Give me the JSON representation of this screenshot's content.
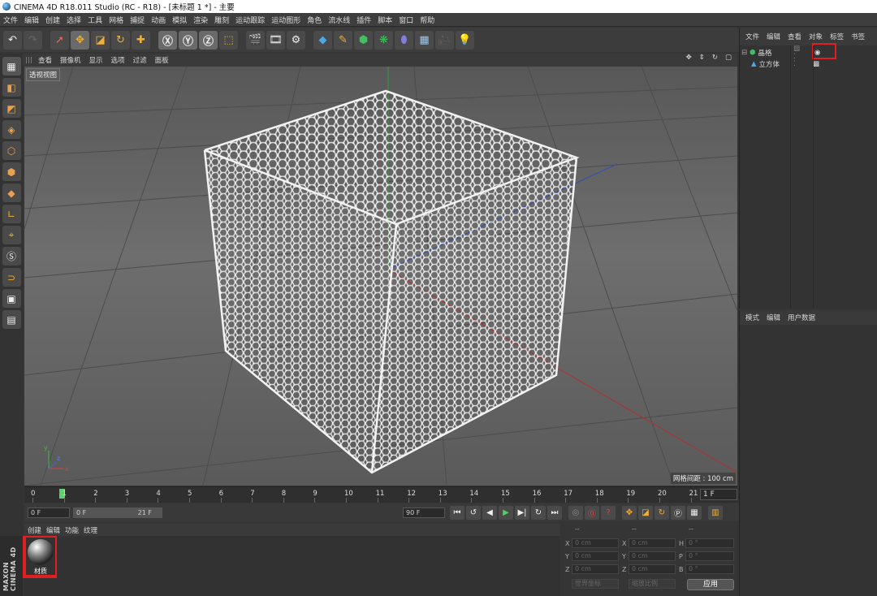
{
  "window": {
    "title": "CINEMA 4D R18.011 Studio (RC - R18) - [未标题 1 *] - 主要"
  },
  "menubar": [
    "文件",
    "编辑",
    "创建",
    "选择",
    "工具",
    "网格",
    "捕捉",
    "动画",
    "模拟",
    "渲染",
    "雕刻",
    "运动跟踪",
    "运动图形",
    "角色",
    "流水线",
    "插件",
    "脚本",
    "窗口",
    "帮助"
  ],
  "toolbar": {
    "icons": [
      "undo-icon",
      "redo-icon",
      "live-select-icon",
      "move-icon",
      "scale-icon",
      "rotate-icon",
      "last-tool-icon",
      "x-axis-icon",
      "y-axis-icon",
      "z-axis-icon",
      "coordinate-system-icon",
      "render-view-icon",
      "render-picture-viewer-icon",
      "render-settings-icon",
      "cube-object-icon",
      "pen-spline-icon",
      "subdivision-surface-icon",
      "cloner-icon",
      "deformer-icon",
      "floor-icon",
      "camera-icon",
      "light-icon"
    ]
  },
  "viewport": {
    "menu": [
      "查看",
      "摄像机",
      "显示",
      "选项",
      "过滤",
      "面板"
    ],
    "label": "透视视图",
    "grid_info": "网格间距 : 100 cm",
    "axis_x": "x",
    "axis_y": "y",
    "axis_z": "z"
  },
  "timeline": {
    "ticks": [
      "0",
      "1",
      "2",
      "3",
      "4",
      "5",
      "6",
      "7",
      "8",
      "9",
      "10",
      "11",
      "12",
      "13",
      "14",
      "15",
      "16",
      "17",
      "18",
      "19",
      "20",
      "21"
    ],
    "current_frame": "1 F"
  },
  "transport": {
    "start": "0 F",
    "range_start": "0 F",
    "range_end": "21 F",
    "end": "90 F"
  },
  "material_manager": {
    "menu": [
      "创建",
      "编辑",
      "功能",
      "纹理"
    ],
    "material_name": "材质"
  },
  "maxon": {
    "brand": "MAXON CINEMA 4D"
  },
  "coordinates": {
    "headers": [
      "--",
      "--",
      "--"
    ],
    "rows": [
      {
        "a": "X",
        "av": "0 cm",
        "b": "X",
        "bv": "0 cm",
        "c": "H",
        "cv": "0 °"
      },
      {
        "a": "Y",
        "av": "0 cm",
        "b": "Y",
        "bv": "0 cm",
        "c": "P",
        "cv": "0 °"
      },
      {
        "a": "Z",
        "av": "0 cm",
        "b": "Z",
        "bv": "0 cm",
        "c": "B",
        "cv": "0 °"
      }
    ],
    "mode_world": "世界坐标",
    "mode_scale": "缩放比例",
    "apply": "应用"
  },
  "object_manager": {
    "menu": [
      "文件",
      "编辑",
      "查看",
      "对象",
      "标签",
      "书签"
    ],
    "objects": [
      {
        "name": "晶格"
      },
      {
        "name": "立方体"
      }
    ]
  },
  "attribute_manager": {
    "menu": [
      "模式",
      "编辑",
      "用户数据"
    ]
  },
  "colors": {
    "highlight": "#e02020",
    "active_frame": "#5fd16a",
    "accent": "#4a90d9"
  }
}
